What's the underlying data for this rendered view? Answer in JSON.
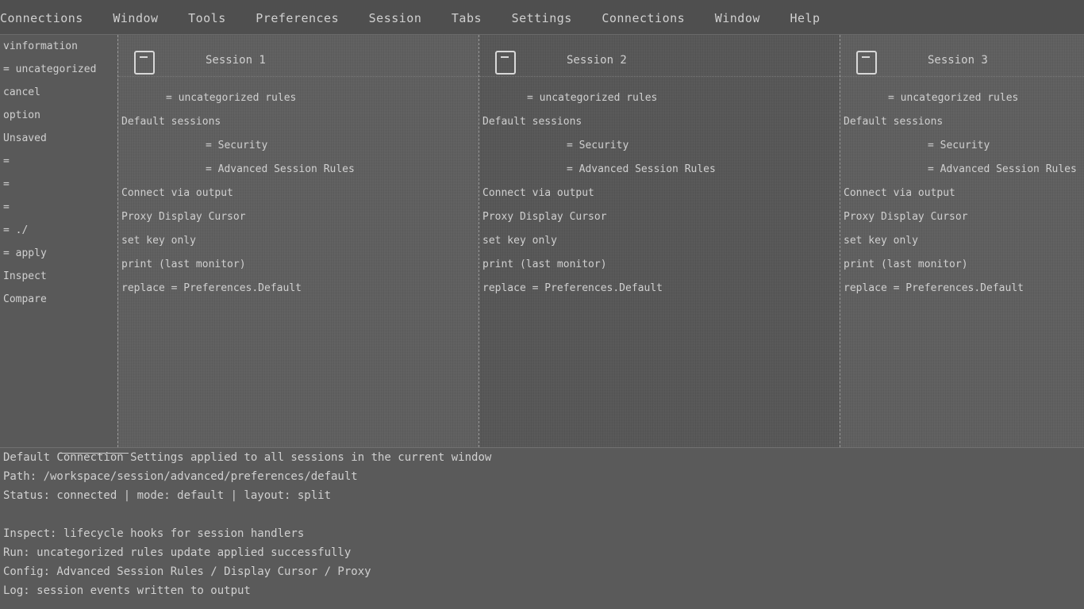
{
  "top_bar": {
    "items": [
      "Connections",
      "Window",
      "Tools",
      "Preferences",
      "Session",
      "Tabs",
      "Settings",
      "Connections",
      "Window",
      "Help"
    ]
  },
  "left_pane": {
    "lines": [
      "vinformation",
      "= uncategorized",
      "cancel",
      "option",
      "Unsaved",
      "=",
      "=",
      "=",
      "= ./",
      "= apply",
      "Inspect",
      "Compare"
    ]
  },
  "panels": [
    {
      "title": "Session 1",
      "lines": [
        "= uncategorized rules",
        "Default sessions",
        "= Security",
        "= Advanced Session Rules",
        "Connect via  output",
        "Proxy  Display Cursor",
        "set key only",
        "print (last monitor)",
        "replace = Preferences.Default"
      ]
    },
    {
      "title": "Session 2",
      "lines": [
        "= uncategorized rules",
        "Default sessions",
        "= Security",
        "= Advanced Session Rules",
        "Connect via  output",
        "Proxy  Display Cursor",
        "set key only",
        "print (last monitor)",
        "replace = Preferences.Default"
      ]
    },
    {
      "title": "Session 3",
      "lines": [
        "= uncategorized rules",
        "Default sessions",
        "= Security",
        "= Advanced Session Rules",
        "Connect via  output",
        "Proxy  Display Cursor",
        "set key only",
        "print (last monitor)",
        "replace = Preferences.Default"
      ]
    }
  ],
  "bottom": {
    "lines": [
      "Default Connection Settings applied to all sessions in the current window",
      "Path: /workspace/session/advanced/preferences/default",
      "Status: connected  |  mode: default  |  layout: split",
      "",
      "Inspect: lifecycle hooks for session handlers",
      "Run: uncategorized rules update applied successfully",
      "Config: Advanced Session Rules / Display Cursor / Proxy",
      "Log: session events written to output"
    ]
  }
}
